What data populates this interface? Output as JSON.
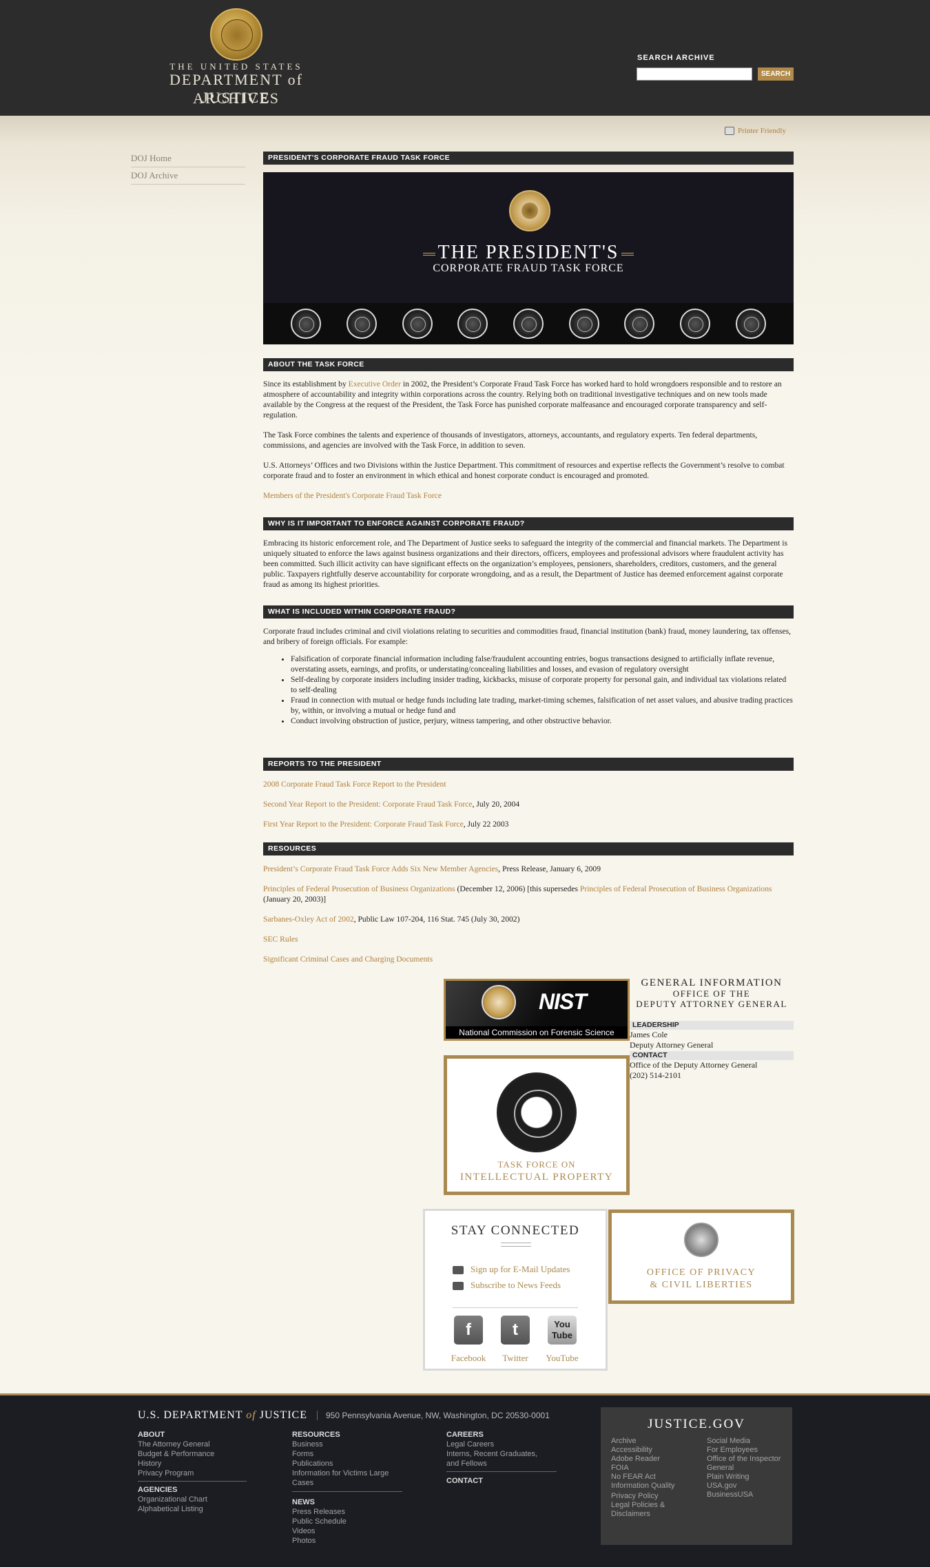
{
  "header": {
    "logo_line1": "THE UNITED STATES",
    "logo_line2": "DEPARTMENT of JUSTICE",
    "logo_line3": "ARCHIVES",
    "search_label": "SEARCH ARCHIVE",
    "search_placeholder": "",
    "search_button": "SEARCH"
  },
  "printer_friendly": "Printer Friendly",
  "sidebar": {
    "items": [
      {
        "label": "DOJ Home"
      },
      {
        "label": "DOJ Archive"
      }
    ]
  },
  "page_title_bar": "PRESIDENT'S CORPORATE FRAUD TASK FORCE",
  "banner": {
    "title": "THE PRESIDENT'S",
    "subtitle": "CORPORATE FRAUD TASK FORCE"
  },
  "about": {
    "heading": "ABOUT THE TASK FORCE",
    "p1_before": "Since its establishment by ",
    "p1_link": "Executive Order",
    "p1_after": " in 2002, the President’s Corporate Fraud Task Force has worked hard to hold wrongdoers responsible and to restore an atmosphere of accountability and integrity within corporations across the country. Relying both on traditional investigative techniques and on new tools made available by the Congress at the request of the President, the Task Force has punished corporate malfeasance and encouraged corporate transparency and self-regulation.",
    "p2": "The Task Force combines the talents and experience of thousands of investigators, attorneys, accountants, and regulatory experts. Ten federal departments, commissions, and agencies are involved with the Task Force, in addition to seven.",
    "p3": "U.S. Attorneys’ Offices and two Divisions within the Justice Department. This commitment of resources and expertise reflects the Government’s resolve to combat corporate fraud and to foster an environment in which ethical and honest corporate conduct is encouraged and promoted.",
    "members_link": "Members of the President's Corporate Fraud Task Force"
  },
  "why": {
    "heading": "WHY IS IT IMPORTANT TO ENFORCE AGAINST CORPORATE FRAUD?",
    "p": "Embracing its historic enforcement role, and The Department of Justice seeks to safeguard the integrity of the commercial and financial markets. The Department is uniquely situated to enforce the laws against business organizations and their directors, officers, employees and professional advisors where fraudulent activity has been committed. Such illicit activity can have significant effects on the organization’s employees, pensioners, shareholders, creditors, customers, and the general public. Taxpayers rightfully deserve accountability for corporate wrongdoing, and as a result, the Department of Justice has deemed enforcement against corporate fraud as among its highest priorities."
  },
  "what": {
    "heading": "WHAT IS INCLUDED WITHIN CORPORATE FRAUD?",
    "p": "Corporate fraud includes criminal and civil violations relating to securities and commodities fraud, financial institution (bank) fraud, money laundering, tax offenses, and bribery of foreign officials. For example:",
    "items": [
      "Falsification of corporate financial information including false/fraudulent accounting entries, bogus transactions designed to artificially inflate revenue, overstating assets, earnings, and profits, or understating/concealing liabilities and losses, and evasion of regulatory oversight",
      "Self-dealing by corporate insiders including insider trading, kickbacks, misuse of corporate property for personal gain, and individual tax violations related to self-dealing",
      "Fraud in connection with mutual or hedge funds including late trading, market-timing schemes, falsification of net asset values, and abusive trading practices by, within, or involving a mutual or hedge fund and",
      "Conduct involving obstruction of justice, perjury, witness tampering, and other obstructive behavior."
    ]
  },
  "reports": {
    "heading": "REPORTS TO THE PRESIDENT",
    "r1_link": "2008 Corporate Fraud Task Force Report to the President",
    "r2_link": "Second Year Report to the President: Corporate Fraud Task Force",
    "r2_after": ", July 20, 2004",
    "r3_link": "First Year Report to the President: Corporate Fraud Task Force",
    "r3_after": ", July 22 2003"
  },
  "resources": {
    "heading": "RESOURCES",
    "res1_link": "President’s Corporate Fraud Task Force Adds Six New Member Agencies",
    "res1_after": ", Press Release, January 6, 2009",
    "res2_link": "Principles of Federal Prosecution of Business Organizations",
    "res2_mid": " (December 12, 2006) [this supersedes ",
    "res2_link2": "Principles of Federal Prosecution of Business Organizations",
    "res2_after": " (January 20, 2003)]",
    "res3_link": "Sarbanes-Oxley Act of 2002",
    "res3_after": ", Public Law 107-204, 116 Stat. 745 (July 30, 2002)",
    "res4_link": "SEC Rules",
    "res5_link": "Significant Criminal Cases and Charging Documents"
  },
  "promos": {
    "nist_word": "NIST",
    "nist_caption": "National Commission on Forensic Science",
    "iptf_line1": "TASK FORCE ON",
    "iptf_line2": "INTELLECTUAL PROPERTY",
    "stay_title": "STAY CONNECTED",
    "stay_email": "Sign up for E-Mail Updates",
    "stay_feeds": "Subscribe to News Feeds",
    "facebook": "Facebook",
    "twitter": "Twitter",
    "youtube": "YouTube",
    "youtube_icon_text": "You Tube",
    "privacy_line1": "OFFICE OF PRIVACY",
    "privacy_line2": "& CIVIL LIBERTIES"
  },
  "general_info": {
    "t1": "GENERAL INFORMATION",
    "t2": "OFFICE OF THE",
    "t3": "DEPUTY ATTORNEY GENERAL",
    "leadership_label": "LEADERSHIP",
    "leader_name": "James Cole",
    "leader_title": "Deputy Attorney General",
    "contact_label": "CONTACT",
    "contact_office": "Office of the Deputy Attorney General",
    "contact_phone": "(202) 514-2101"
  },
  "footer": {
    "logo_left": "U.S. DEPARTMENT",
    "logo_of": "of",
    "logo_right": "JUSTICE",
    "address": "950 Pennsylvania Avenue, NW, Washington, DC 20530-0001",
    "about_head": "ABOUT",
    "about_links": [
      "The Attorney General",
      "Budget & Performance",
      "History",
      "Privacy Program"
    ],
    "agencies_head": "AGENCIES",
    "agencies_links": [
      "Organizational Chart",
      "Alphabetical Listing"
    ],
    "resources_head": "RESOURCES",
    "resources_links": [
      "Business",
      "Forms",
      "Publications",
      "Information for Victims Large Cases"
    ],
    "news_head": "NEWS",
    "news_links": [
      "Press Releases",
      "Public Schedule",
      "Videos",
      "Photos"
    ],
    "careers_head": "CAREERS",
    "careers_links": [
      "Legal Careers",
      "Interns, Recent Graduates, and Fellows"
    ],
    "contact_head": "CONTACT",
    "justice_title": "JUSTICE.GOV",
    "jg_left": [
      "Archive",
      "Accessibility",
      "Adobe Reader",
      "FOIA",
      "No FEAR Act",
      "Information Quality",
      "Privacy Policy",
      "Legal Policies & Disclaimers"
    ],
    "jg_right": [
      "Social Media",
      "For Employees",
      "Office of the Inspector General",
      "Plain Writing",
      "USA.gov",
      "BusinessUSA"
    ]
  }
}
